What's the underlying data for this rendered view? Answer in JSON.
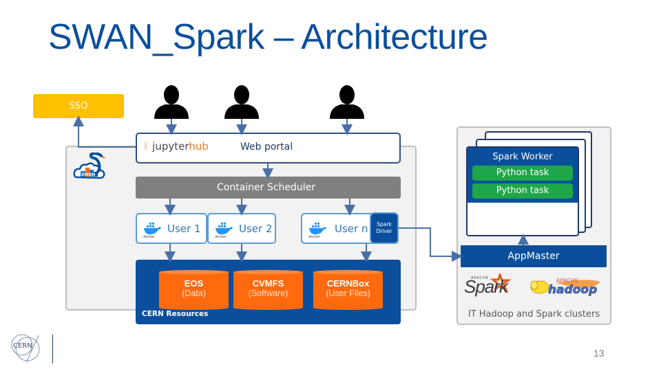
{
  "slide": {
    "title": "SWAN_Spark – Architecture",
    "page_number": "13"
  },
  "sso": {
    "label": "SSO"
  },
  "users": [
    {
      "icon": "user-silhouette-icon"
    },
    {
      "icon": "user-silhouette-icon"
    },
    {
      "icon": "user-silhouette-icon"
    }
  ],
  "swan": {
    "logo_text": "SWAN",
    "jupyterhub": {
      "prefix": "jupyter",
      "suffix": "hub"
    },
    "web_portal_label": "Web portal",
    "scheduler_label": "Container Scheduler",
    "containers": [
      {
        "label": "User 1",
        "icon": "docker-icon",
        "icon_text": "docker"
      },
      {
        "label": "User 2",
        "icon": "docker-icon",
        "icon_text": "docker"
      },
      {
        "label": "User n",
        "icon": "docker-icon",
        "icon_text": "docker"
      }
    ],
    "spark_driver_label": "Spark Driver"
  },
  "cern_resources": {
    "label": "CERN Resources",
    "storages": [
      {
        "name": "EOS",
        "desc": "(Data)"
      },
      {
        "name": "CVMFS",
        "desc": "(Software)"
      },
      {
        "name": "CERNBox",
        "desc": "(User Files)"
      }
    ]
  },
  "cluster": {
    "worker_title": "Spark Worker",
    "tasks": [
      "Python task",
      "Python task"
    ],
    "appmaster_label": "AppMaster",
    "spark_logo": {
      "small": "APACHE",
      "text": "Spark"
    },
    "hadoop_logo": {
      "small": "APACHE",
      "text": "hadoop"
    },
    "label": "IT Hadoop and Spark clusters"
  },
  "footer": {
    "logo_text": "CERN"
  },
  "colors": {
    "title_blue": "#0b4f9c",
    "sso_yellow": "#ffc000",
    "storage_orange": "#ff6a0e",
    "task_green": "#1fa64b",
    "scheduler_gray": "#808080",
    "connector_blue": "#4a6fa5"
  }
}
